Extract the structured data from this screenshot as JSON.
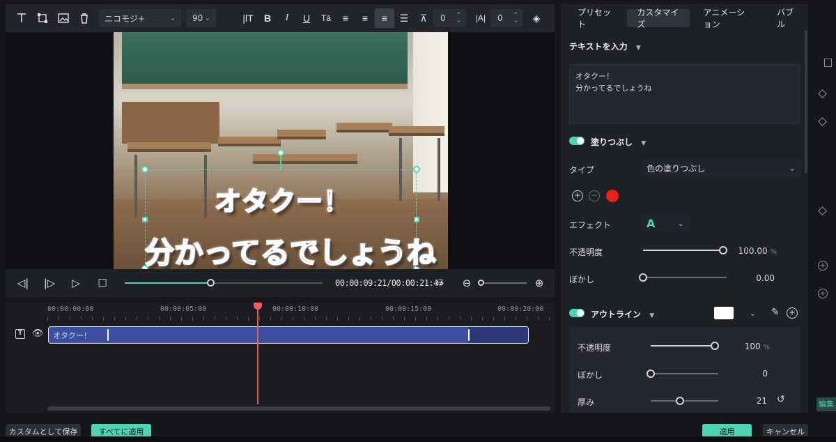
{
  "toolbar": {
    "font_name": "ニコモジ+",
    "font_size": "90",
    "letter_spacing": "0",
    "line_spacing": "0"
  },
  "preview": {
    "caption_line1": "オタクー！",
    "caption_line2": "分かってるでしょうね"
  },
  "playback": {
    "time": "00:00:09:21/00:00:21:47",
    "progress": 0.43
  },
  "timeline": {
    "ruler": [
      "00:00:00:00",
      "00:00:05:00",
      "00:00:10:00",
      "00:00:15:00",
      "00:00:20:00"
    ],
    "clip_label": "オタクー！"
  },
  "panel": {
    "tabs": [
      {
        "label": "プリセット"
      },
      {
        "label": "カスタマイズ"
      },
      {
        "label": "アニメーション"
      },
      {
        "label": "バブル"
      }
    ],
    "text_input_heading": "テキストを入力",
    "text_value": "オタクー！\n分かってるでしょうね",
    "fill": {
      "heading": "塗りつぶし",
      "type_label": "タイプ",
      "type_value": "色の塗りつぶし",
      "effect_label": "エフェクト",
      "effect_value": "A",
      "opacity_label": "不透明度",
      "opacity_value": "100.00",
      "opacity_unit": "%",
      "opacity_level": 1.0,
      "blur_label": "ぼかし",
      "blur_value": "0.00",
      "blur_level": 0.0,
      "color": "#ee1f16"
    },
    "outline": {
      "heading": "アウトライン",
      "color": "#ffffff",
      "opacity_label": "不透明度",
      "opacity_value": "100",
      "opacity_unit": "%",
      "opacity_level": 1.0,
      "blur_label": "ぼかし",
      "blur_value": "0",
      "blur_level": 0.0,
      "thickness_label": "厚み",
      "thickness_value": "21",
      "thickness_level": 0.43
    }
  },
  "buttons": {
    "save_custom": "カスタムとして保存",
    "apply_all": "すべてに適用",
    "apply": "適用",
    "cancel": "キャンセル"
  },
  "side": {
    "edit_label": "編集"
  },
  "colors": {
    "accent": "#4fd3b5",
    "playhead": "#ec5c5c",
    "clip": "#3c4ea2"
  }
}
